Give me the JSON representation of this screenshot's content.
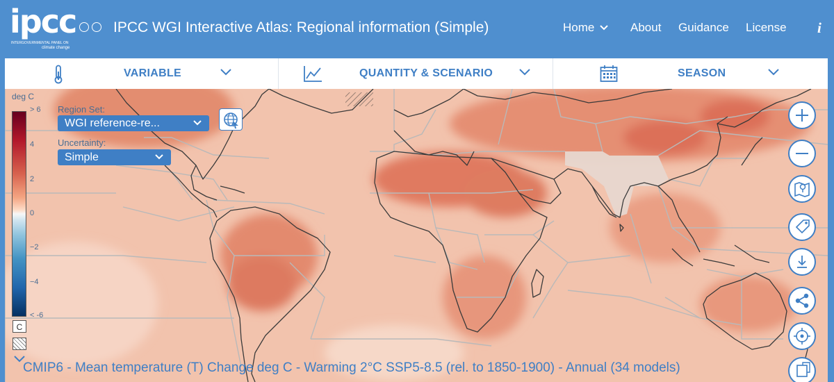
{
  "header": {
    "logo_text": "ipcc",
    "logo_subtitle": "INTERGOVERNMENTAL PANEL ON",
    "logo_subtitle2": "climate change",
    "title": "IPCC WGI Interactive Atlas: Regional information (Simple)",
    "nav": {
      "home": "Home",
      "about": "About",
      "guidance": "Guidance",
      "license": "License",
      "info": "i"
    }
  },
  "selectors": {
    "variable": "VARIABLE",
    "quantity": "QUANTITY & SCENARIO",
    "season": "SEASON"
  },
  "legend": {
    "unit": "deg C",
    "ticks": [
      "> 6",
      "4",
      "2",
      "0",
      "−2",
      "−4",
      "< -6"
    ],
    "c_box": "C"
  },
  "controls": {
    "region_set_label": "Region Set:",
    "region_set_value": "WGI reference-re...",
    "uncertainty_label": "Uncertainty:",
    "uncertainty_value": "Simple"
  },
  "caption": "CMIP6 - Mean temperature (T) Change deg C - Warming 2°C SSP5-8.5 (rel. to 1850-1900) - Annual (34 models)",
  "icons": {
    "variable": "thermometer-icon",
    "quantity": "line-chart-icon",
    "season": "calendar-icon",
    "zoom_in": "plus-icon",
    "zoom_out": "minus-icon",
    "map": "map-pin-icon",
    "tag": "tag-icon",
    "download": "download-icon",
    "share": "share-icon",
    "locate": "crosshair-icon",
    "fullscreen": "expand-icon"
  },
  "colors": {
    "header_bg": "#4f8fcf",
    "accent": "#3f7fc5",
    "warm_map": "#eda187",
    "hot_map": "#d9674f",
    "ocean_map": "#f3c4ae",
    "selected_region": "#e6d4cc"
  }
}
